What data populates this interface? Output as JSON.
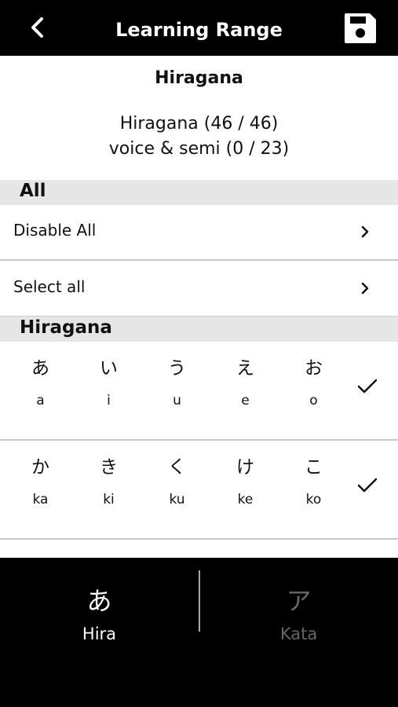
{
  "header": {
    "title": "Learning Range",
    "back_icon": "chevron-left-icon",
    "save_icon": "floppy-disk-icon"
  },
  "summary": {
    "subtitle": "Hiragana",
    "line1": "Hiragana (46 / 46)",
    "line2": "voice & semi (0 / 23)"
  },
  "sections": {
    "all": {
      "header": "All",
      "items": [
        {
          "label": "Disable All"
        },
        {
          "label": "Select all"
        }
      ]
    },
    "hiragana": {
      "header": "Hiragana",
      "rows": [
        {
          "selected": true,
          "cells": [
            {
              "kana": "あ",
              "romaji": "a"
            },
            {
              "kana": "い",
              "romaji": "i"
            },
            {
              "kana": "う",
              "romaji": "u"
            },
            {
              "kana": "え",
              "romaji": "e"
            },
            {
              "kana": "お",
              "romaji": "o"
            }
          ]
        },
        {
          "selected": true,
          "cells": [
            {
              "kana": "か",
              "romaji": "ka"
            },
            {
              "kana": "き",
              "romaji": "ki"
            },
            {
              "kana": "く",
              "romaji": "ku"
            },
            {
              "kana": "け",
              "romaji": "ke"
            },
            {
              "kana": "こ",
              "romaji": "ko"
            }
          ]
        }
      ]
    }
  },
  "tabs": [
    {
      "glyph": "あ",
      "label": "Hira",
      "active": true,
      "color": "#ffffff"
    },
    {
      "glyph": "ア",
      "label": "Kata",
      "active": false,
      "color": "#666666"
    }
  ]
}
